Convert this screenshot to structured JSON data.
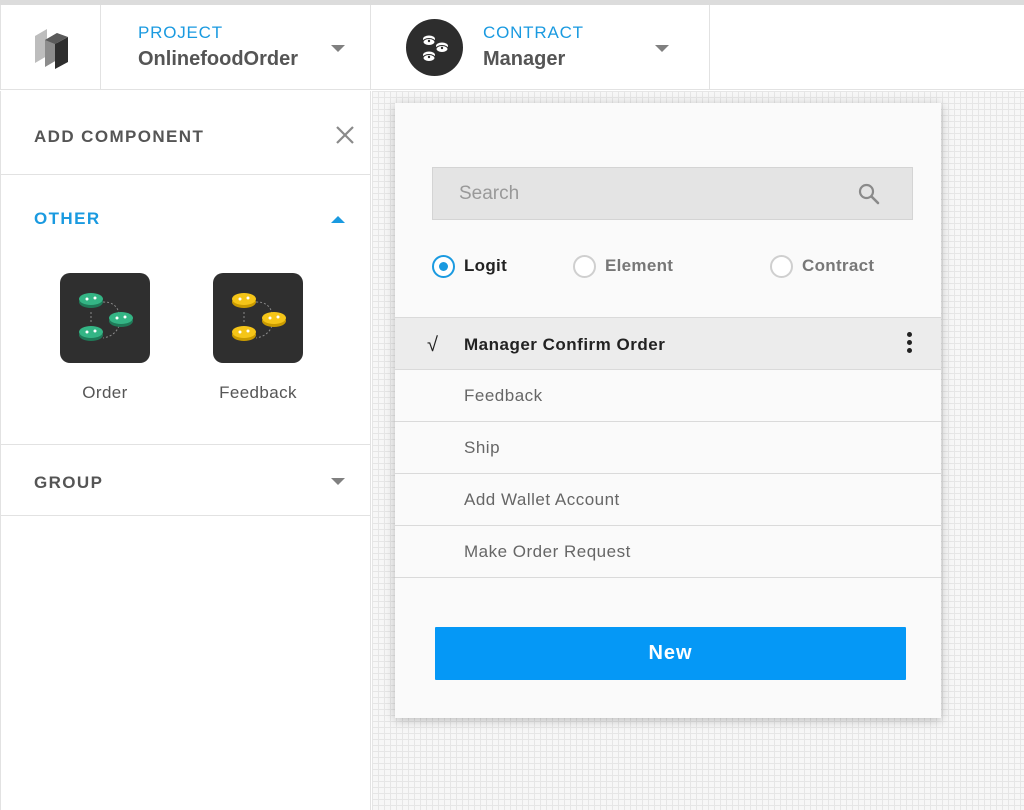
{
  "header": {
    "project_label": "PROJECT",
    "project_value": "OnlinefoodOrder",
    "contract_label": "CONTRACT",
    "contract_value": "Manager"
  },
  "panel": {
    "title": "ADD COMPONENT",
    "sections": {
      "other": {
        "title": "OTHER",
        "expanded": true,
        "components": [
          {
            "label": "Order",
            "icon": "green-coins-icon",
            "color": "#2fa37a"
          },
          {
            "label": "Feedback",
            "icon": "yellow-coins-icon",
            "color": "#f5c518"
          }
        ]
      },
      "group": {
        "title": "GROUP",
        "expanded": false
      }
    }
  },
  "card": {
    "search_placeholder": "Search",
    "radios": [
      {
        "label": "Logit",
        "selected": true
      },
      {
        "label": "Element",
        "selected": false
      },
      {
        "label": "Contract",
        "selected": false
      }
    ],
    "items": [
      {
        "label": "Manager Confirm Order",
        "selected": true
      },
      {
        "label": "Feedback",
        "selected": false
      },
      {
        "label": "Ship",
        "selected": false
      },
      {
        "label": "Add Wallet Account",
        "selected": false
      },
      {
        "label": "Make Order Request",
        "selected": false
      }
    ],
    "check_glyph": "√",
    "new_label": "New"
  },
  "colors": {
    "accent": "#1a9ae0",
    "button": "#0598f6",
    "tile": "#2f2f2f"
  }
}
